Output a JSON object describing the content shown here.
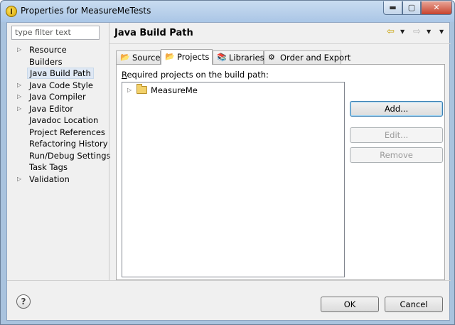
{
  "window": {
    "title": "Properties for MeasureMeTests",
    "minimize_glyph": "▬",
    "maximize_glyph": "▢",
    "close_glyph": "✕"
  },
  "filter": {
    "placeholder": "type filter text"
  },
  "sidebar": {
    "items": [
      {
        "label": "Resource",
        "expandable": true
      },
      {
        "label": "Builders",
        "expandable": false
      },
      {
        "label": "Java Build Path",
        "expandable": false,
        "selected": true
      },
      {
        "label": "Java Code Style",
        "expandable": true
      },
      {
        "label": "Java Compiler",
        "expandable": true
      },
      {
        "label": "Java Editor",
        "expandable": true
      },
      {
        "label": "Javadoc Location",
        "expandable": false
      },
      {
        "label": "Project References",
        "expandable": false
      },
      {
        "label": "Refactoring History",
        "expandable": false
      },
      {
        "label": "Run/Debug Settings",
        "expandable": false
      },
      {
        "label": "Task Tags",
        "expandable": false
      },
      {
        "label": "Validation",
        "expandable": true
      }
    ]
  },
  "page": {
    "title": "Java Build Path"
  },
  "tabs": [
    {
      "label": "Source",
      "icon": "source-folder-icon"
    },
    {
      "label": "Projects",
      "icon": "open-folder-icon",
      "active": true
    },
    {
      "label": "Libraries",
      "icon": "library-icon"
    },
    {
      "label": "Order and Export",
      "icon": "order-export-icon"
    }
  ],
  "projects": {
    "label_mnemonic": "R",
    "label_rest": "equired projects on the build path:",
    "tree": [
      {
        "label": "MeasureMe",
        "expandable": true
      }
    ],
    "buttons": {
      "add": "Add...",
      "edit": "Edit...",
      "remove": "Remove"
    }
  },
  "footer": {
    "help": "?",
    "ok": "OK",
    "cancel": "Cancel"
  },
  "colors": {
    "titlebar": "#aac6e6",
    "client_bg": "#f0f0f0",
    "accent_border": "#3c7fb1",
    "folder": "#f2d16b"
  }
}
